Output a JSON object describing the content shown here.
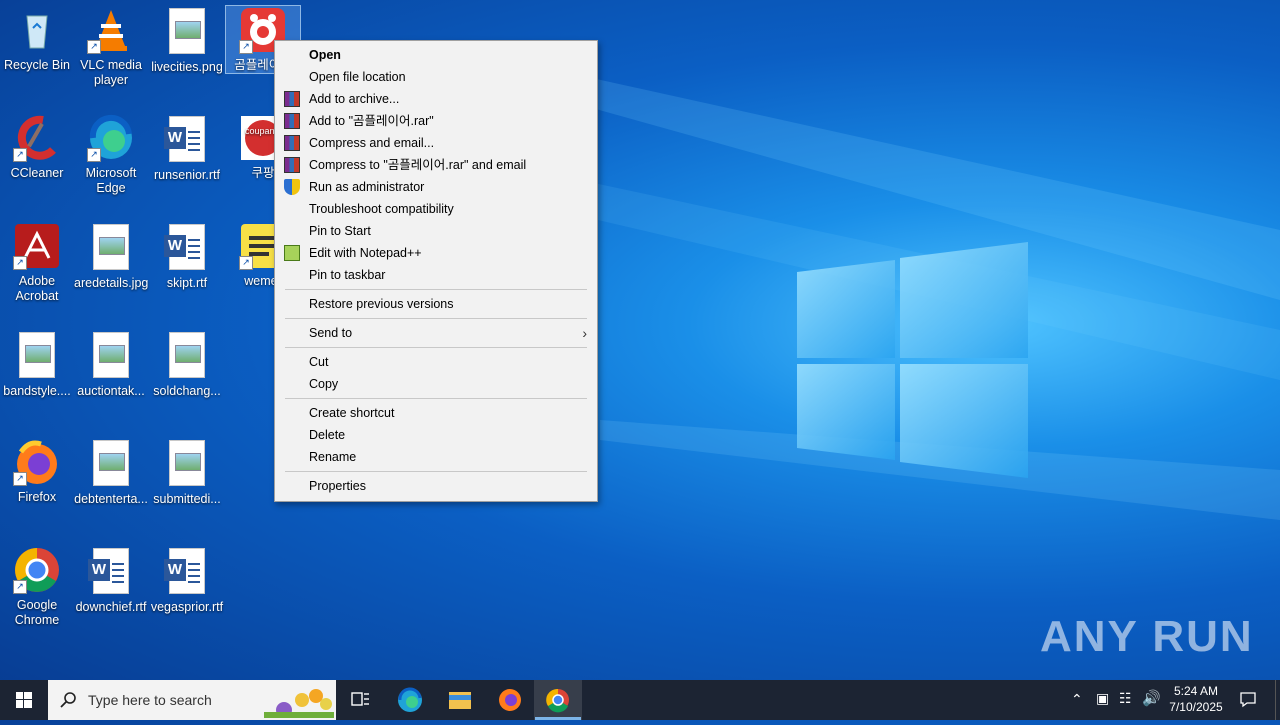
{
  "desktop_icons": [
    {
      "label": "Recycle Bin",
      "icon": "recycle-bin-icon"
    },
    {
      "label": "VLC media player",
      "icon": "vlc-icon"
    },
    {
      "label": "livecities.png",
      "icon": "image-file-icon"
    },
    {
      "label": "곰플레이어",
      "icon": "gom-player-icon"
    },
    {
      "label": "CCleaner",
      "icon": "ccleaner-icon"
    },
    {
      "label": "Microsoft Edge",
      "icon": "edge-icon"
    },
    {
      "label": "runsenior.rtf",
      "icon": "word-file-icon"
    },
    {
      "label": "쿠팡",
      "icon": "coupang-icon"
    },
    {
      "label": "Adobe Acrobat",
      "icon": "acrobat-icon"
    },
    {
      "label": "aredetails.jpg",
      "icon": "image-file-icon"
    },
    {
      "label": "skipt.rtf",
      "icon": "word-file-icon"
    },
    {
      "label": "wemer",
      "icon": "sticky-notes-icon"
    },
    {
      "label": "bandstyle....",
      "icon": "image-file-icon"
    },
    {
      "label": "auctiontak...",
      "icon": "image-file-icon"
    },
    {
      "label": "soldchang...",
      "icon": "image-file-icon"
    },
    {
      "label": "Firefox",
      "icon": "firefox-icon"
    },
    {
      "label": "debtenterta...",
      "icon": "image-file-icon"
    },
    {
      "label": "submittedi...",
      "icon": "image-file-icon"
    },
    {
      "label": "Google Chrome",
      "icon": "chrome-icon"
    },
    {
      "label": "downchief.rtf",
      "icon": "word-file-icon"
    },
    {
      "label": "vegasprior.rtf",
      "icon": "word-file-icon"
    }
  ],
  "context_menu": {
    "items": [
      {
        "label": "Open",
        "bold": true
      },
      {
        "label": "Open file location"
      },
      {
        "label": "Add to archive...",
        "icon": "winrar-icon"
      },
      {
        "label": "Add to \"곰플레이어.rar\"",
        "icon": "winrar-icon"
      },
      {
        "label": "Compress and email...",
        "icon": "winrar-icon"
      },
      {
        "label": "Compress to \"곰플레이어.rar\" and email",
        "icon": "winrar-icon"
      },
      {
        "label": "Run as administrator",
        "icon": "uac-shield-icon"
      },
      {
        "label": "Troubleshoot compatibility"
      },
      {
        "label": "Pin to Start"
      },
      {
        "label": "Edit with Notepad++",
        "icon": "notepadpp-icon"
      },
      {
        "label": "Pin to taskbar"
      },
      {
        "label": "Restore previous versions"
      },
      {
        "label": "Send to",
        "submenu": true
      },
      {
        "label": "Cut"
      },
      {
        "label": "Copy"
      },
      {
        "label": "Create shortcut"
      },
      {
        "label": "Delete"
      },
      {
        "label": "Rename"
      },
      {
        "label": "Properties"
      }
    ]
  },
  "taskbar": {
    "search_placeholder": "Type here to search",
    "apps": [
      "task-view-icon",
      "edge-icon",
      "file-explorer-icon",
      "firefox-icon",
      "chrome-icon"
    ],
    "time": "5:24 AM",
    "date": "7/10/2025"
  },
  "watermark": "ANY RUN",
  "colors": {
    "menu_bg": "#f2f2f2",
    "taskbar_bg": "#1c2433",
    "accent": "#0b5fc4"
  }
}
